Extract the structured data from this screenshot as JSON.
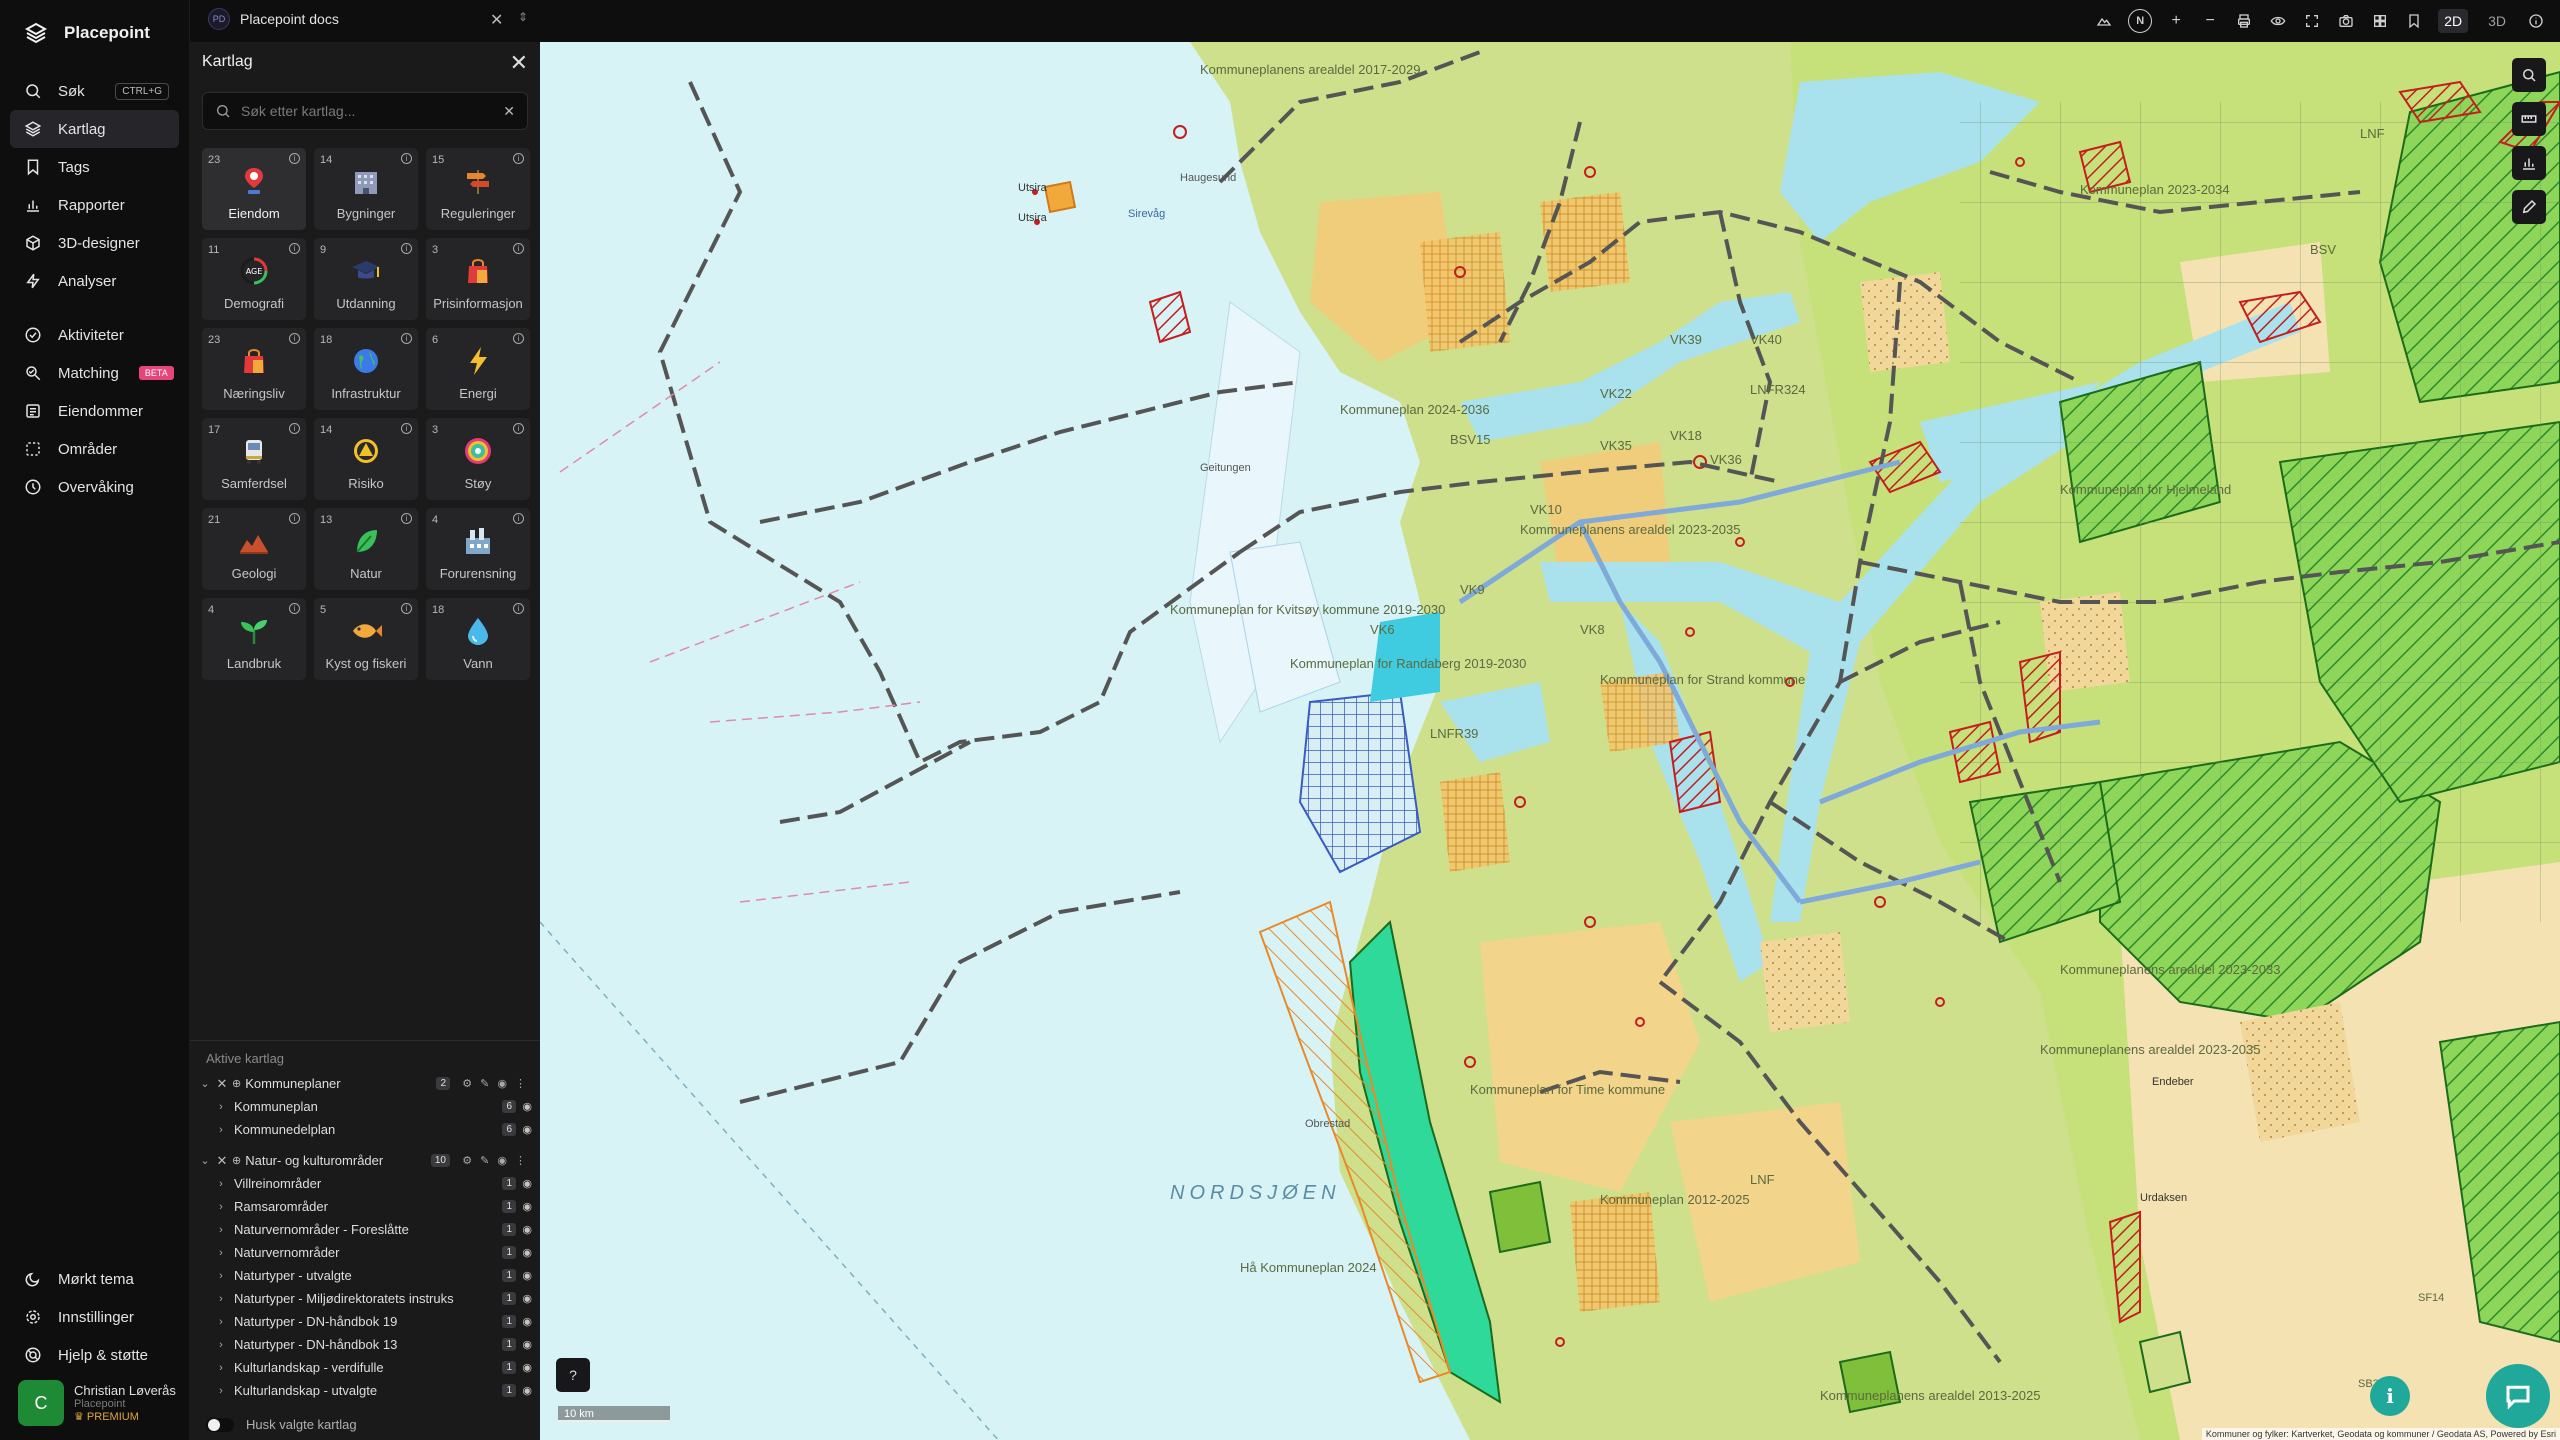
{
  "app": {
    "name": "Placepoint",
    "doc_title": "Placepoint docs",
    "doc_badge": "PD"
  },
  "nav": {
    "main": [
      {
        "label": "Søk",
        "icon": "search-icon",
        "shortcut": "CTRL+G"
      },
      {
        "label": "Kartlag",
        "icon": "layers-icon",
        "active": true
      },
      {
        "label": "Tags",
        "icon": "bookmark-icon"
      },
      {
        "label": "Rapporter",
        "icon": "bar-chart-icon"
      },
      {
        "label": "3D-designer",
        "icon": "cube-icon"
      },
      {
        "label": "Analyser",
        "icon": "lightning-icon"
      }
    ],
    "secondary": [
      {
        "label": "Aktiviteter",
        "icon": "activity-icon"
      },
      {
        "label": "Matching",
        "icon": "match-icon",
        "badge": "BETA"
      },
      {
        "label": "Eiendommer",
        "icon": "list-icon"
      },
      {
        "label": "Områder",
        "icon": "area-icon"
      },
      {
        "label": "Overvåking",
        "icon": "monitor-icon"
      }
    ],
    "bottom": [
      {
        "label": "Mørkt tema",
        "icon": "moon-icon"
      },
      {
        "label": "Innstillinger",
        "icon": "gear-icon"
      },
      {
        "label": "Hjelp & støtte",
        "icon": "help-icon"
      }
    ]
  },
  "user": {
    "initial": "C",
    "name": "Christian Løverås",
    "org": "Placepoint",
    "plan": "PREMIUM"
  },
  "topbar": {
    "compass": "N",
    "dim_2d": "2D",
    "dim_3d": "3D",
    "active_dim": "2D"
  },
  "panel": {
    "title": "Kartlag",
    "search_placeholder": "Søk etter kartlag...",
    "categories": [
      {
        "count": "23",
        "label": "Eiendom",
        "icon": "pin-icon"
      },
      {
        "count": "14",
        "label": "Bygninger",
        "icon": "building-icon"
      },
      {
        "count": "15",
        "label": "Reguleringer",
        "icon": "signpost-icon"
      },
      {
        "count": "11",
        "label": "Demografi",
        "icon": "age-icon"
      },
      {
        "count": "9",
        "label": "Utdanning",
        "icon": "graduation-icon"
      },
      {
        "count": "3",
        "label": "Prisinformasjon",
        "icon": "shopping-bag-icon"
      },
      {
        "count": "23",
        "label": "Næringsliv",
        "icon": "shopping-bag-icon"
      },
      {
        "count": "18",
        "label": "Infrastruktur",
        "icon": "globe-icon"
      },
      {
        "count": "6",
        "label": "Energi",
        "icon": "bolt-icon"
      },
      {
        "count": "17",
        "label": "Samferdsel",
        "icon": "bus-icon"
      },
      {
        "count": "14",
        "label": "Risiko",
        "icon": "warning-icon"
      },
      {
        "count": "3",
        "label": "Støy",
        "icon": "noise-icon"
      },
      {
        "count": "21",
        "label": "Geologi",
        "icon": "terrain-icon"
      },
      {
        "count": "13",
        "label": "Natur",
        "icon": "leaf-icon"
      },
      {
        "count": "4",
        "label": "Forurensning",
        "icon": "factory-icon"
      },
      {
        "count": "4",
        "label": "Landbruk",
        "icon": "sprout-icon"
      },
      {
        "count": "5",
        "label": "Kyst og fiskeri",
        "icon": "fish-icon"
      },
      {
        "count": "18",
        "label": "Vann",
        "icon": "drop-icon"
      }
    ],
    "active_title": "Aktive kartlag",
    "groups": [
      {
        "name": "Kommuneplaner",
        "count": "2",
        "children": [
          {
            "name": "Kommuneplan",
            "count": "6"
          },
          {
            "name": "Kommunedelplan",
            "count": "6"
          }
        ]
      },
      {
        "name": "Natur- og kulturområder",
        "count": "10",
        "children": [
          {
            "name": "Villreinområder",
            "count": "1"
          },
          {
            "name": "Ramsarområder",
            "count": "1"
          },
          {
            "name": "Naturvernområder - Foreslåtte",
            "count": "1"
          },
          {
            "name": "Naturvernområder",
            "count": "1"
          },
          {
            "name": "Naturtyper - utvalgte",
            "count": "1"
          },
          {
            "name": "Naturtyper - Miljødirektoratets instruks",
            "count": "1"
          },
          {
            "name": "Naturtyper - DN-håndbok 19",
            "count": "1"
          },
          {
            "name": "Naturtyper - DN-håndbok 13",
            "count": "1"
          },
          {
            "name": "Kulturlandskap - verdifulle",
            "count": "1"
          },
          {
            "name": "Kulturlandskap - utvalgte",
            "count": "1"
          }
        ]
      }
    ],
    "remember_label": "Husk valgte kartlag"
  },
  "map": {
    "sea_label": "NORDSJØEN",
    "scale_label": "10 km",
    "attribution": "Kommuner og fylker: Kartverket, Geodata og kommuner / Geodata AS, Powered by Esri",
    "labels": [
      "Kommuneplanens arealdel 2017-2029",
      "Kommuneplan 2023-2034",
      "Kommuneplan 2024-2036",
      "Kommuneplan for Kvitsøy kommune 2019-2030",
      "Kommuneplan for Randaberg 2019-2030",
      "Kommuneplan for Strand kommune",
      "Kommuneplanens arealdel 2023-2035",
      "Kommuneplanens arealdel 2023-2035",
      "Kommuneplan for Time kommune",
      "Kommuneplan 2012-2025",
      "Hå Kommuneplan 2024",
      "Kommuneplanens arealdel 2013-2025",
      "Kommuneplanens arealdel 2023-2033",
      "Kommuneplan for Hjelmeland",
      "Utsira",
      "Utsira",
      "Sirevåg",
      "Haugesund",
      "Geitungen",
      "Obrestad",
      "VK39",
      "VK40",
      "VK22",
      "VK18",
      "VK35",
      "VK36",
      "VK10",
      "VK9",
      "VK8",
      "VK6",
      "LNFR324",
      "LNFR39",
      "LNF",
      "BSV",
      "LNF",
      "BSV15",
      "Endeber",
      "Urdaksen",
      "SB3",
      "SF14"
    ]
  }
}
